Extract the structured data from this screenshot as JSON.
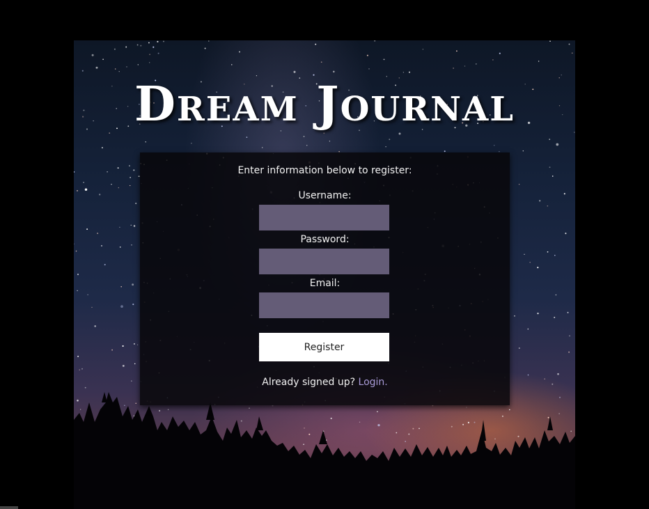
{
  "header": {
    "title": "Dream Journal"
  },
  "form": {
    "intro": "Enter information below to register:",
    "username_label": "Username:",
    "username_value": "",
    "password_label": "Password:",
    "password_value": "",
    "email_label": "Email:",
    "email_value": "",
    "submit_label": "Register",
    "footer_text": "Already signed up?",
    "login_link": "Login."
  },
  "colors": {
    "field_bg": "#645c77",
    "link": "#a99bd8",
    "panel_bg": "#08070a"
  }
}
